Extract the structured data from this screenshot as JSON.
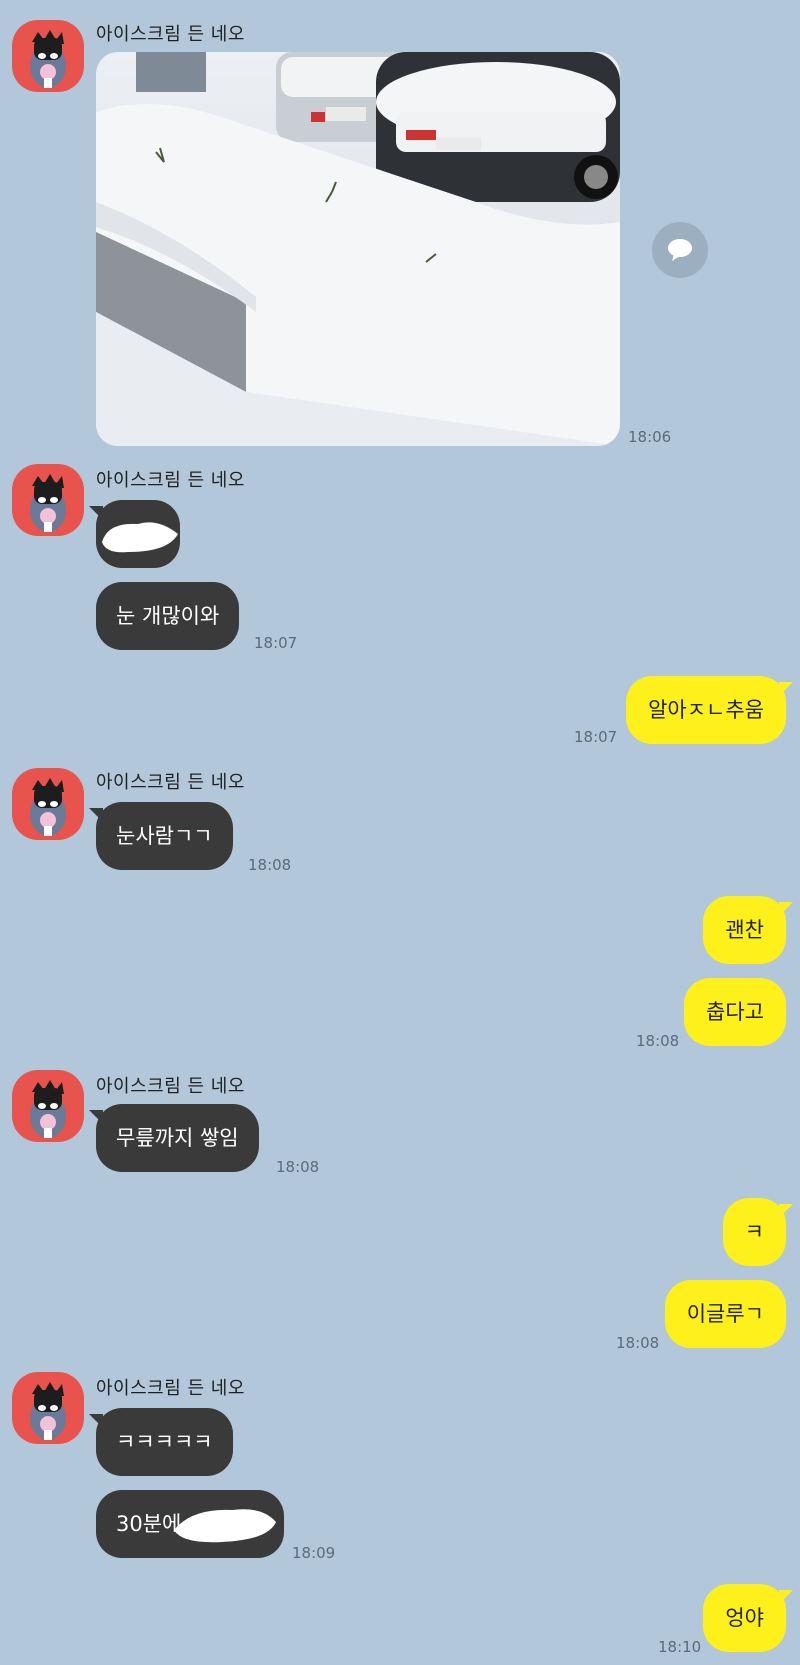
{
  "colors": {
    "background": "#b2c7da",
    "received_bubble": "#3a3a3a",
    "sent_bubble": "#fef01b",
    "avatar_bg": "#e9534d"
  },
  "sender_name": "아이스크림 든 네오",
  "messages": {
    "m1": {
      "type": "photo",
      "time": "18:06"
    },
    "m2": {
      "text": "",
      "redacted": true
    },
    "m3": {
      "text": "눈 개많이와",
      "time": "18:07"
    },
    "m4": {
      "text": "알아ㅈㄴ추움",
      "time": "18:07"
    },
    "m5": {
      "text": "눈사람ㄱㄱ",
      "time": "18:08"
    },
    "m6": {
      "text": "괜찬"
    },
    "m7": {
      "text": "춥다고",
      "time": "18:08"
    },
    "m8": {
      "text": "무릎까지 쌓임",
      "time": "18:08"
    },
    "m9": {
      "text": "ㅋ"
    },
    "m10": {
      "text": "이글루ㄱ",
      "time": "18:08"
    },
    "m11": {
      "text": "ㅋㅋㅋㅋㅋ"
    },
    "m12": {
      "text": "30분에",
      "time": "18:09",
      "partially_redacted": true
    },
    "m13": {
      "text": "엉야",
      "time": "18:10"
    }
  },
  "icons": {
    "share": "speech-bubble-icon",
    "avatar": "neo-character-avatar"
  }
}
